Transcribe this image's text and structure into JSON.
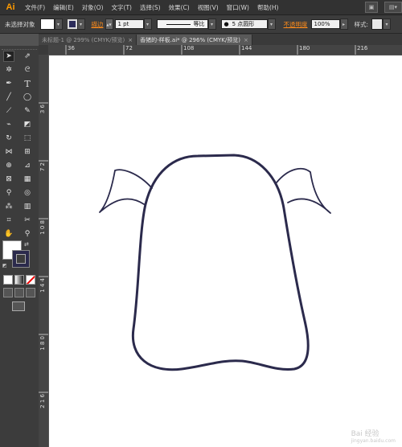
{
  "app": {
    "logo": "Ai"
  },
  "menu": {
    "items": [
      "文件(F)",
      "编辑(E)",
      "对象(O)",
      "文字(T)",
      "选择(S)",
      "效果(C)",
      "视图(V)",
      "窗口(W)",
      "帮助(H)"
    ]
  },
  "control_bar": {
    "selection_label": "未选择对象",
    "stroke_label": "描边",
    "stroke_weight": "1 pt",
    "profile_label": "等比",
    "brush_label": "5 点圆形",
    "opacity_label": "不透明度",
    "opacity_value": "100%",
    "style_label": "样式:"
  },
  "tabs": [
    {
      "label": "未标题-1 @ 299% (CMYK/预览)",
      "active": false
    },
    {
      "label": "香猪的-样板.ai* @ 296% (CMYK/预览)",
      "active": true
    }
  ],
  "ruler": {
    "h_labels": [
      "36",
      "72",
      "108",
      "144",
      "180",
      "216"
    ],
    "v_labels": [
      "3 6",
      "7 2",
      "1 0 8",
      "1 4 4",
      "1 8 0",
      "2 1 6"
    ]
  },
  "canvas": {
    "stroke_color": "#2b2a4c",
    "background": "#ffffff"
  },
  "watermark": {
    "main": "Bai 经验",
    "sub": "jingyan.baidu.com"
  },
  "colors": {
    "accent": "#ff8c1a",
    "chrome_dark": "#323232",
    "panel": "#3c3c3c"
  }
}
